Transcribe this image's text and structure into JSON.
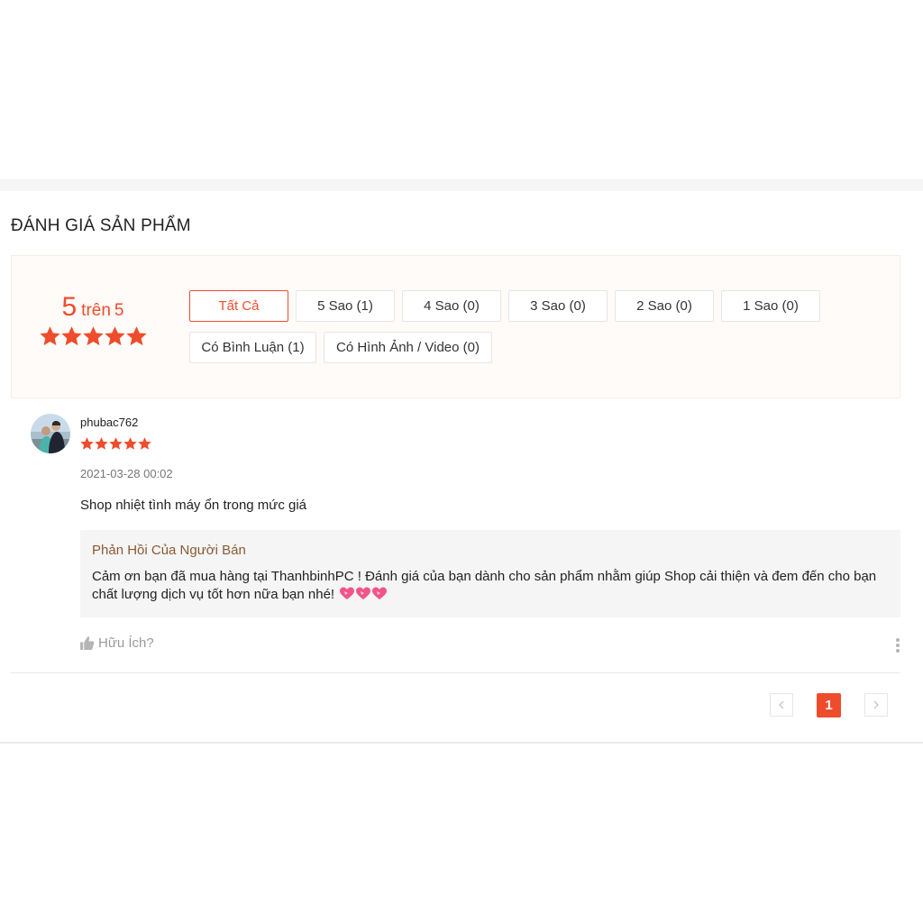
{
  "section_title": "ĐÁNH GIÁ SẢN PHẨM",
  "overview": {
    "score": "5",
    "score_separator": "trên",
    "score_max": "5",
    "rating_value": 5,
    "rating_out_of": 5,
    "filters": [
      {
        "label": "Tất Cả",
        "active": true
      },
      {
        "label": "5 Sao (1)",
        "active": false
      },
      {
        "label": "4 Sao (0)",
        "active": false
      },
      {
        "label": "3 Sao (0)",
        "active": false
      },
      {
        "label": "2 Sao (0)",
        "active": false
      },
      {
        "label": "1 Sao (0)",
        "active": false
      },
      {
        "label": "Có Bình Luận (1)",
        "active": false
      },
      {
        "label": "Có Hình Ảnh / Video (0)",
        "active": false
      }
    ]
  },
  "review": {
    "username": "phubac762",
    "rating": 5,
    "time": "2021-03-28 00:02",
    "text": "Shop nhiệt tình máy ổn trong mức giá",
    "seller_reply": {
      "title": "Phản Hồi Của Người Bán",
      "text": "Cảm ơn bạn đã mua hàng tại ThanhbinhPC ! Đánh giá của bạn dành cho sản phẩm nhằm giúp Shop cải thiện và đem đến cho bạn chất lượng dịch vụ tốt hơn nữa bạn nhé!",
      "emoji_icons": [
        "sparkling-heart-icon",
        "sparkling-heart-icon",
        "sparkling-heart-icon"
      ]
    },
    "helpful_label": "Hữu Ích?"
  },
  "pagination": {
    "current_page": "1",
    "prev_icon": "chevron-left-icon",
    "next_icon": "chevron-right-icon"
  },
  "colors": {
    "accent": "#ee4d2d",
    "overview_bg": "#fffbf8",
    "reply_bg": "#f5f5f5",
    "reply_title": "#8a5a35"
  }
}
